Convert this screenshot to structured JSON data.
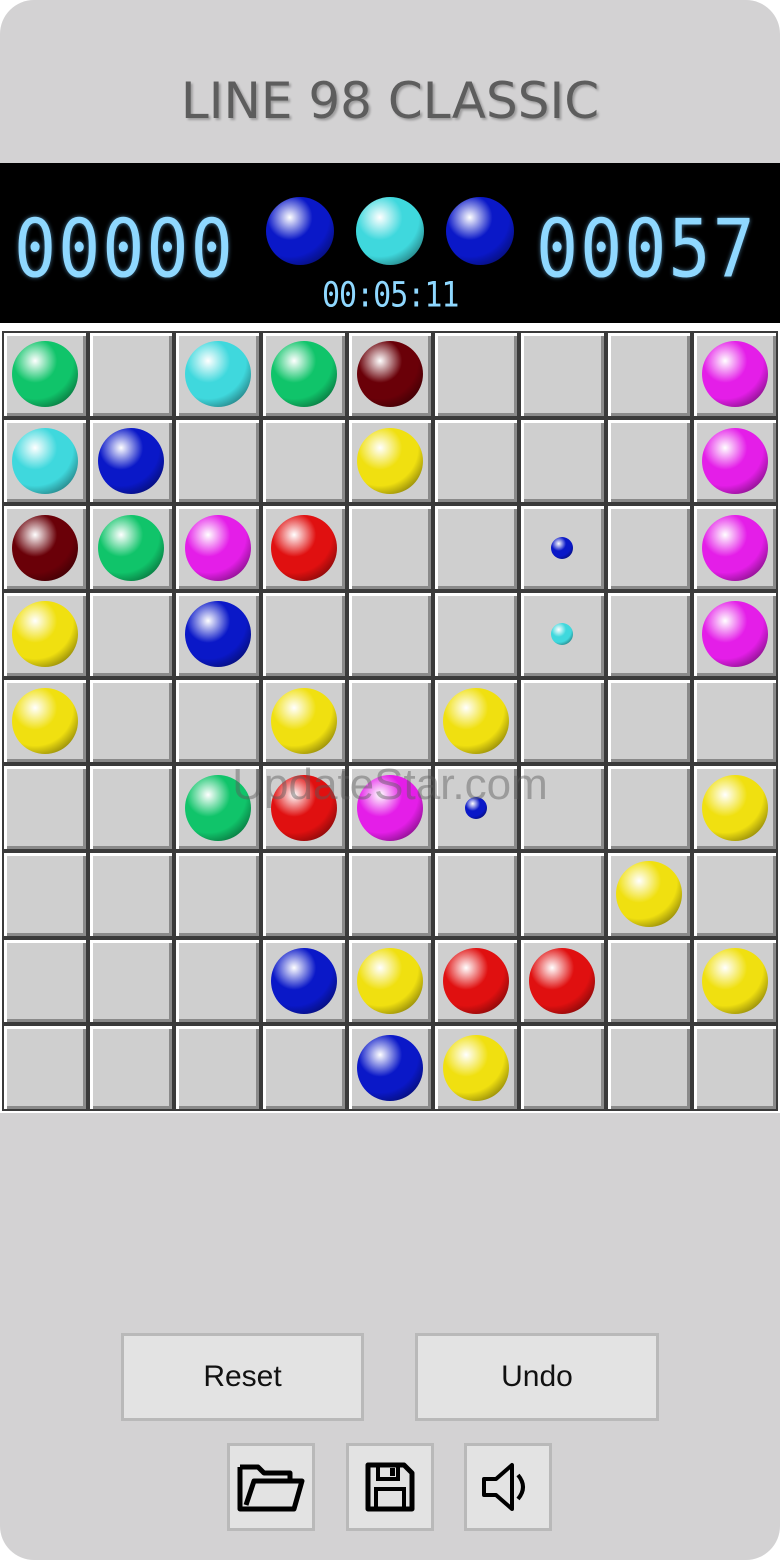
{
  "title": "LINE 98 CLASSIC",
  "scorebar": {
    "score": "00000",
    "high_score": "00057",
    "timer": "00:05:11",
    "next_balls": [
      "blue",
      "cyan",
      "blue"
    ]
  },
  "colors": {
    "green": "#10c46a",
    "cyan": "#3fd8dd",
    "darkred": "#6a0008",
    "magenta": "#e41ee8",
    "blue": "#0a18c8",
    "yellow": "#f0e010",
    "red": "#e01010"
  },
  "board": {
    "rows": 9,
    "cols": 9,
    "cells": [
      [
        "green",
        "",
        "cyan",
        "green",
        "darkred",
        "",
        "",
        "",
        "magenta"
      ],
      [
        "cyan",
        "blue",
        "",
        "",
        "yellow",
        "",
        "",
        "",
        "magenta"
      ],
      [
        "darkred",
        "green",
        "magenta",
        "red",
        "",
        "",
        "small-blue",
        "",
        "magenta"
      ],
      [
        "yellow",
        "",
        "blue",
        "",
        "",
        "",
        "small-cyan",
        "",
        "magenta"
      ],
      [
        "yellow",
        "",
        "",
        "yellow",
        "",
        "yellow",
        "",
        "",
        ""
      ],
      [
        "",
        "",
        "green",
        "red",
        "magenta",
        "small-blue",
        "",
        "",
        "yellow"
      ],
      [
        "",
        "",
        "",
        "",
        "",
        "",
        "",
        "yellow",
        ""
      ],
      [
        "",
        "",
        "",
        "blue",
        "yellow",
        "red",
        "red",
        "",
        "yellow"
      ],
      [
        "",
        "",
        "",
        "",
        "blue",
        "yellow",
        "",
        "",
        ""
      ]
    ]
  },
  "watermark": "UpdateStar.com",
  "buttons": {
    "reset_label": "Reset",
    "undo_label": "Undo"
  },
  "icons": {
    "open": "folder-open-icon",
    "save": "floppy-disk-icon",
    "sound": "speaker-icon"
  }
}
